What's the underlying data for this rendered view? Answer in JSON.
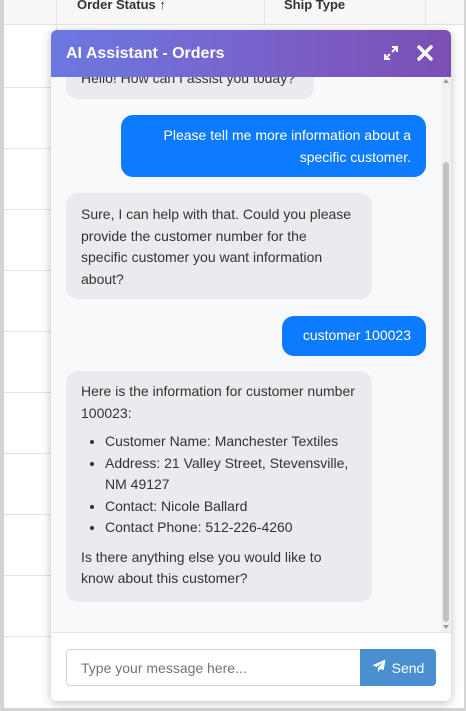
{
  "background": {
    "columns": [
      "Order Status ↑",
      "Ship Type"
    ]
  },
  "chat": {
    "title": "AI Assistant - Orders",
    "icons": {
      "expand": "expand-icon",
      "close": "close-icon",
      "send": "paper-plane-icon"
    },
    "colors": {
      "header_start": "#6b78e0",
      "header_end": "#7b4fb3",
      "user_bubble": "#0d7bff",
      "bot_bubble": "#e9ebee",
      "send_button": "#4a8fd0"
    },
    "messages": [
      {
        "role": "assistant",
        "text": "Hello! How can I assist you today?"
      },
      {
        "role": "user",
        "text": "Please tell me more information about a specific customer."
      },
      {
        "role": "assistant",
        "text": "Sure, I can help with that. Could you please provide the customer number for the specific customer you want information about?"
      },
      {
        "role": "user",
        "text": "customer 100023"
      },
      {
        "role": "assistant",
        "intro": "Here is the information for customer number 100023:",
        "items": [
          "Customer Name: Manchester Textiles",
          "Address: 21 Valley Street, Stevensville, NM 49127",
          "Contact: Nicole Ballard",
          "Contact Phone: 512-226-4260"
        ],
        "outro": "Is there anything else you would like to know about this customer?"
      }
    ],
    "input": {
      "placeholder": "Type your message here...",
      "value": ""
    },
    "send_label": "Send"
  }
}
